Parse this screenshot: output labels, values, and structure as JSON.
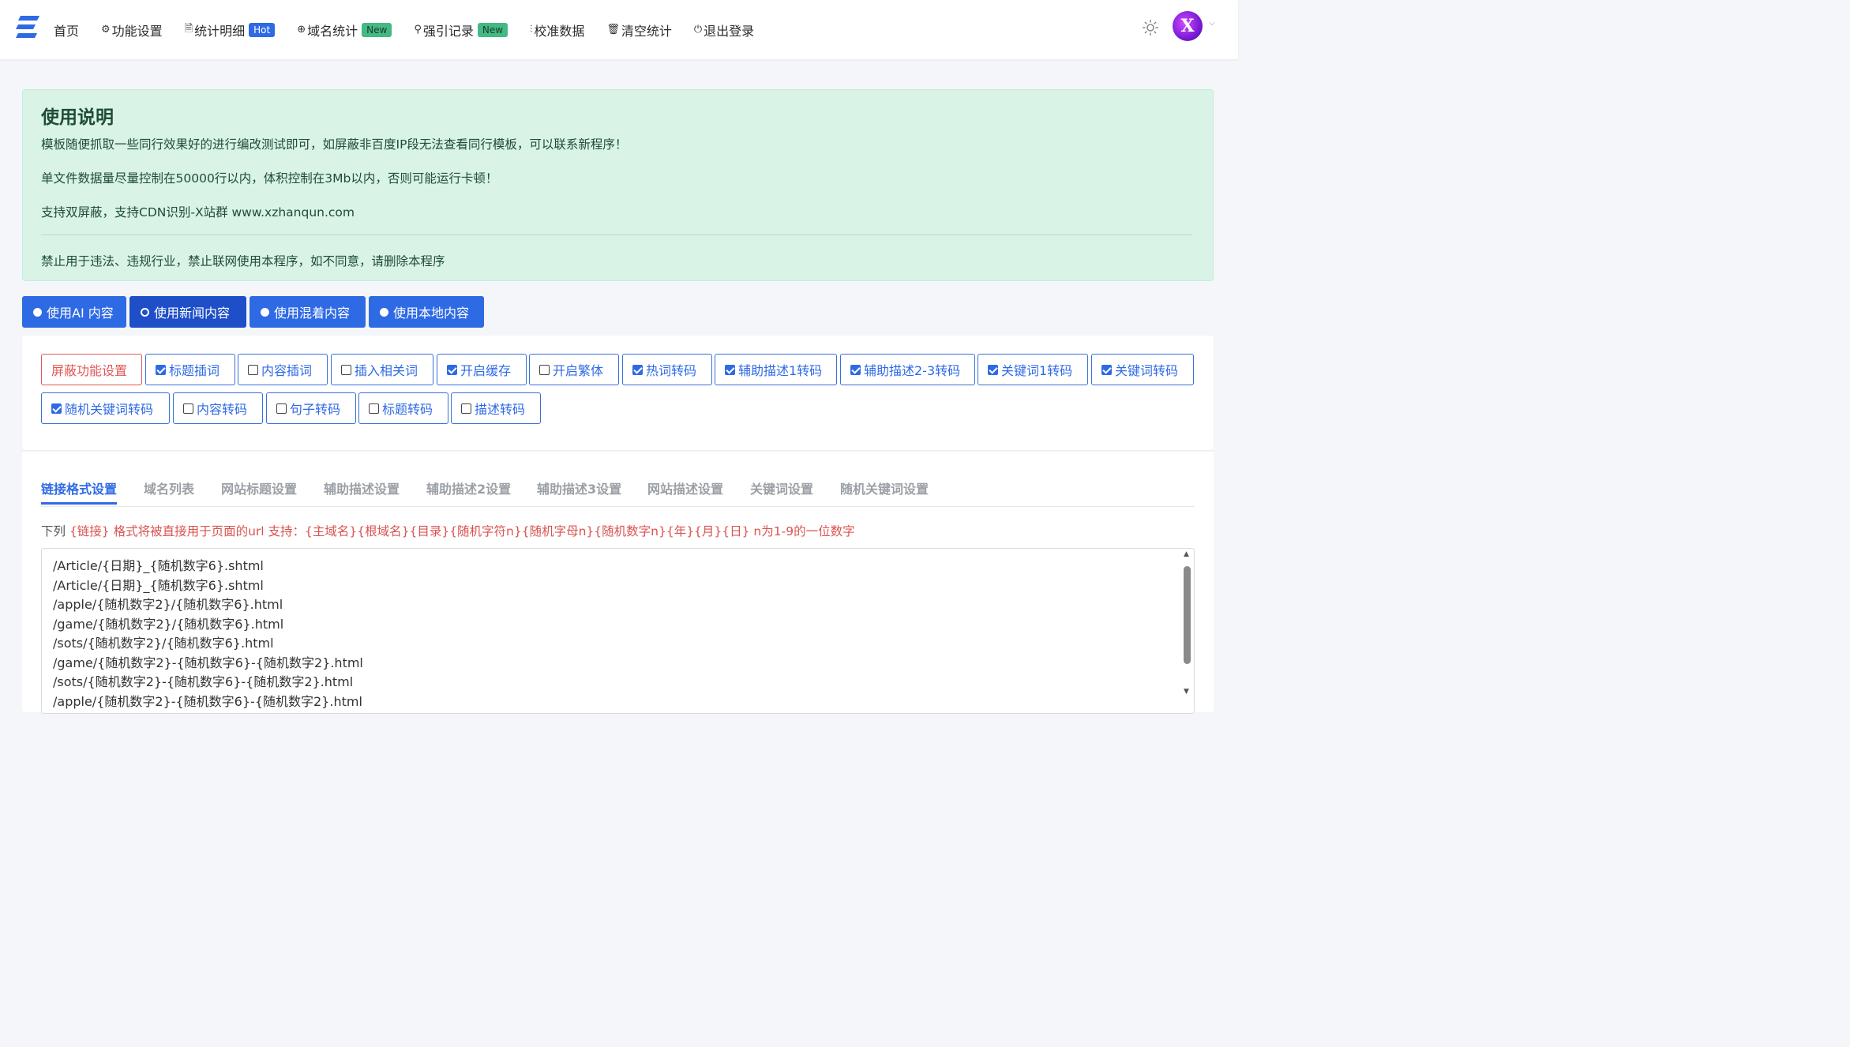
{
  "nav": {
    "items": [
      {
        "icon": "",
        "label": "首页"
      },
      {
        "icon": "⚙",
        "label": "功能设置"
      },
      {
        "icon": "🗎",
        "label": "统计明细",
        "badge": "Hot",
        "badge_type": "hot"
      },
      {
        "icon": "⊕",
        "label": "域名统计",
        "badge": "New",
        "badge_type": "new"
      },
      {
        "icon": "⚲",
        "label": "强引记录",
        "badge": "New",
        "badge_type": "new"
      },
      {
        "icon": "⫶",
        "label": "校准数据"
      },
      {
        "icon": "🗑",
        "label": "清空统计"
      },
      {
        "icon": "⏻",
        "label": "退出登录"
      }
    ],
    "avatar_letter": "X"
  },
  "notice": {
    "title": "使用说明",
    "lines": [
      "模板随便抓取一些同行效果好的进行编改测试即可，如屏蔽非百度IP段无法查看同行模板，可以联系新程序！",
      "单文件数据量尽量控制在50000行以内，体积控制在3Mb以内，否则可能运行卡顿！",
      "支持双屏蔽，支持CDN识别-X站群 www.xzhanqun.com",
      "禁止用于违法、违规行业，禁止联网使用本程序，如不同意，请删除本程序"
    ]
  },
  "modes": [
    {
      "label": "使用AI 内容",
      "selected": false
    },
    {
      "label": "使用新闻内容",
      "selected": true
    },
    {
      "label": "使用混着内容",
      "selected": false
    },
    {
      "label": "使用本地内容",
      "selected": false
    }
  ],
  "options": [
    {
      "label": "屏蔽功能设置",
      "type": "danger"
    },
    {
      "label": "标题插词",
      "checked": true
    },
    {
      "label": "内容插词",
      "checked": false
    },
    {
      "label": "插入相关词",
      "checked": false
    },
    {
      "label": "开启缓存",
      "checked": true
    },
    {
      "label": "开启繁体",
      "checked": false
    },
    {
      "label": "热词转码",
      "checked": true
    },
    {
      "label": "辅助描述1转码",
      "checked": true
    },
    {
      "label": "辅助描述2-3转码",
      "checked": true
    },
    {
      "label": "关键词1转码",
      "checked": true
    },
    {
      "label": "关键词转码",
      "checked": true
    },
    {
      "label": "随机关键词转码",
      "checked": true
    },
    {
      "label": "内容转码",
      "checked": false
    },
    {
      "label": "句子转码",
      "checked": false
    },
    {
      "label": "标题转码",
      "checked": false
    },
    {
      "label": "描述转码",
      "checked": false
    }
  ],
  "tabs": [
    {
      "label": "链接格式设置",
      "active": true
    },
    {
      "label": "域名列表"
    },
    {
      "label": "网站标题设置"
    },
    {
      "label": "辅助描述设置"
    },
    {
      "label": "辅助描述2设置"
    },
    {
      "label": "辅助描述3设置"
    },
    {
      "label": "网站描述设置"
    },
    {
      "label": "关键词设置"
    },
    {
      "label": "随机关键词设置"
    }
  ],
  "hint": {
    "lead": "下列 ",
    "text": "{链接} 格式将被直接用于页面的url 支持：{主域名}{根域名}{目录}{随机字符n}{随机字母n}{随机数字n}{年}{月}{日} n为1-9的一位数字"
  },
  "link_formats": [
    "/Article/{日期}_{随机数字6}.shtml",
    "/Article/{日期}_{随机数字6}.shtml",
    "/apple/{随机数字2}/{随机数字6}.html",
    "/game/{随机数字2}/{随机数字6}.html",
    "/sots/{随机数字2}/{随机数字6}.html",
    "/game/{随机数字2}-{随机数字6}-{随机数字2}.html",
    "/sots/{随机数字2}-{随机数字6}-{随机数字2}.html",
    "/apple/{随机数字2}-{随机数字6}-{随机数字2}.html"
  ],
  "colors": {
    "primary": "#2f6ae5",
    "danger": "#e05858",
    "notice_bg": "#d9f3e6"
  }
}
